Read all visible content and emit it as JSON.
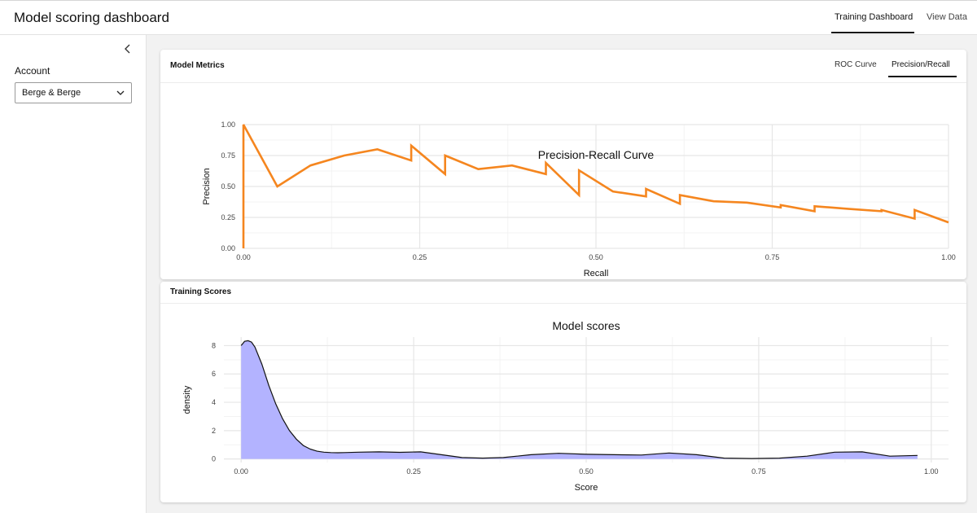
{
  "header": {
    "title": "Model scoring dashboard",
    "tabs": [
      {
        "label": "Training Dashboard",
        "active": true
      },
      {
        "label": "View Data",
        "active": false
      }
    ]
  },
  "sidebar": {
    "collapse_icon": "chevron-left-icon",
    "account_label": "Account",
    "account_value": "Berge & Berge",
    "dropdown_icon": "chevron-down-icon"
  },
  "metrics_card": {
    "title": "Model Metrics",
    "tabs": [
      {
        "label": "ROC Curve",
        "active": false
      },
      {
        "label": "Precision/Recall",
        "active": true
      }
    ]
  },
  "scores_card": {
    "title": "Training Scores"
  },
  "colors": {
    "pr_line": "#f5861f",
    "density_fill": "#b3b3ff",
    "density_line": "#111111",
    "grid": "#e6e6e6"
  },
  "chart_data": [
    {
      "type": "line",
      "title": "Precision-Recall Curve",
      "xlabel": "Recall",
      "ylabel": "Precision",
      "xlim": [
        0,
        1
      ],
      "ylim": [
        0,
        1
      ],
      "xticks": [
        "0.00",
        "0.25",
        "0.50",
        "0.75",
        "1.00"
      ],
      "yticks": [
        "0.00",
        "0.25",
        "0.50",
        "0.75",
        "1.00"
      ],
      "grid": true,
      "series": [
        {
          "x": [
            0.0,
            0.0,
            0.048,
            0.095,
            0.143,
            0.19,
            0.238,
            0.238,
            0.286,
            0.286,
            0.333,
            0.381,
            0.429,
            0.429,
            0.476,
            0.476,
            0.524,
            0.571,
            0.571,
            0.619,
            0.619,
            0.667,
            0.714,
            0.762,
            0.762,
            0.81,
            0.81,
            0.857,
            0.905,
            0.905,
            0.952,
            0.952,
            1.0
          ],
          "y": [
            0.0,
            1.0,
            0.5,
            0.67,
            0.75,
            0.8,
            0.71,
            0.83,
            0.6,
            0.75,
            0.64,
            0.67,
            0.6,
            0.69,
            0.43,
            0.63,
            0.46,
            0.42,
            0.48,
            0.36,
            0.43,
            0.38,
            0.37,
            0.33,
            0.35,
            0.3,
            0.34,
            0.32,
            0.3,
            0.31,
            0.24,
            0.31,
            0.21
          ]
        }
      ]
    },
    {
      "type": "area",
      "title": "Model scores",
      "xlabel": "Score",
      "ylabel": "density",
      "xlim": [
        -0.025,
        1.025
      ],
      "ylim": [
        -0.25,
        8.6
      ],
      "xticks": [
        "0.00",
        "0.25",
        "0.50",
        "0.75",
        "1.00"
      ],
      "yticks": [
        "0",
        "2",
        "4",
        "6",
        "8"
      ],
      "grid": true,
      "series": [
        {
          "x": [
            0.0,
            0.005,
            0.01,
            0.015,
            0.02,
            0.03,
            0.04,
            0.05,
            0.06,
            0.07,
            0.08,
            0.09,
            0.1,
            0.11,
            0.12,
            0.13,
            0.14,
            0.15,
            0.17,
            0.2,
            0.23,
            0.26,
            0.29,
            0.32,
            0.35,
            0.38,
            0.42,
            0.46,
            0.5,
            0.54,
            0.58,
            0.62,
            0.66,
            0.7,
            0.74,
            0.78,
            0.82,
            0.86,
            0.9,
            0.94,
            0.98
          ],
          "y": [
            8.0,
            8.3,
            8.35,
            8.25,
            7.9,
            6.7,
            5.2,
            3.9,
            2.85,
            2.0,
            1.4,
            0.95,
            0.7,
            0.55,
            0.48,
            0.45,
            0.44,
            0.45,
            0.48,
            0.5,
            0.47,
            0.5,
            0.3,
            0.1,
            0.06,
            0.1,
            0.3,
            0.4,
            0.33,
            0.3,
            0.28,
            0.42,
            0.3,
            0.06,
            0.03,
            0.06,
            0.2,
            0.48,
            0.5,
            0.2,
            0.25
          ]
        }
      ]
    }
  ]
}
